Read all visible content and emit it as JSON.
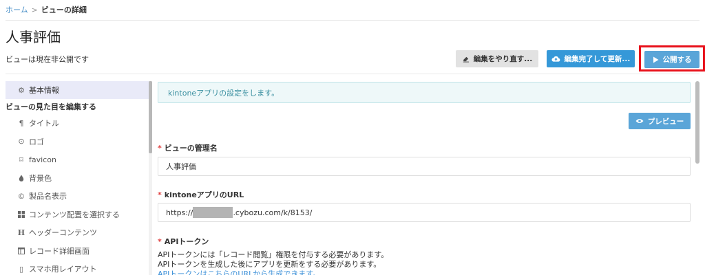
{
  "breadcrumb": {
    "home": "ホーム",
    "separator": ">",
    "current": "ビューの詳細"
  },
  "page": {
    "title": "人事評価",
    "status": "ビューは現在非公開です"
  },
  "actions": {
    "redo_label": "編集をやり直す...",
    "update_label": "編集完了して更新...",
    "publish_label": "公開する",
    "preview_label": "プレビュー"
  },
  "sidebar": {
    "basic": "基本情報",
    "section_header": "ビューの見た目を編集する",
    "items": [
      {
        "label": "タイトル",
        "icon": "¶"
      },
      {
        "label": "ロゴ",
        "icon": "⊙"
      },
      {
        "label": "favicon",
        "icon": "⌑"
      },
      {
        "label": "背景色",
        "icon": "💧"
      },
      {
        "label": "製品名表示",
        "icon": "©"
      },
      {
        "label": "コンテンツ配置を選択する",
        "icon": "▦"
      },
      {
        "label": "ヘッダーコンテンツ",
        "icon": "H"
      },
      {
        "label": "レコード詳細画面",
        "icon": "◫"
      },
      {
        "label": "スマホ用レイアウト",
        "icon": "▯"
      }
    ]
  },
  "main": {
    "info": "kintoneアプリの設定をします。",
    "fields": {
      "view_name_label": "ビューの管理名",
      "view_name_value": "人事評価",
      "url_label": "kintoneアプリのURL",
      "url_prefix": "https://",
      "url_suffix": ".cybozu.com/k/8153/",
      "token_label": "APIトークン"
    },
    "token_help": [
      "APIトークンには「レコード閲覧」権限を付与する必要があります。",
      "APIトークンを生成した後にアプリを更新をする必要があります。"
    ],
    "token_link": "APIトークンはこちらのURLから生成できます。"
  },
  "colors": {
    "accent": "#3598d8",
    "highlight": "#e8101a",
    "info_bg": "#eef8f9"
  }
}
